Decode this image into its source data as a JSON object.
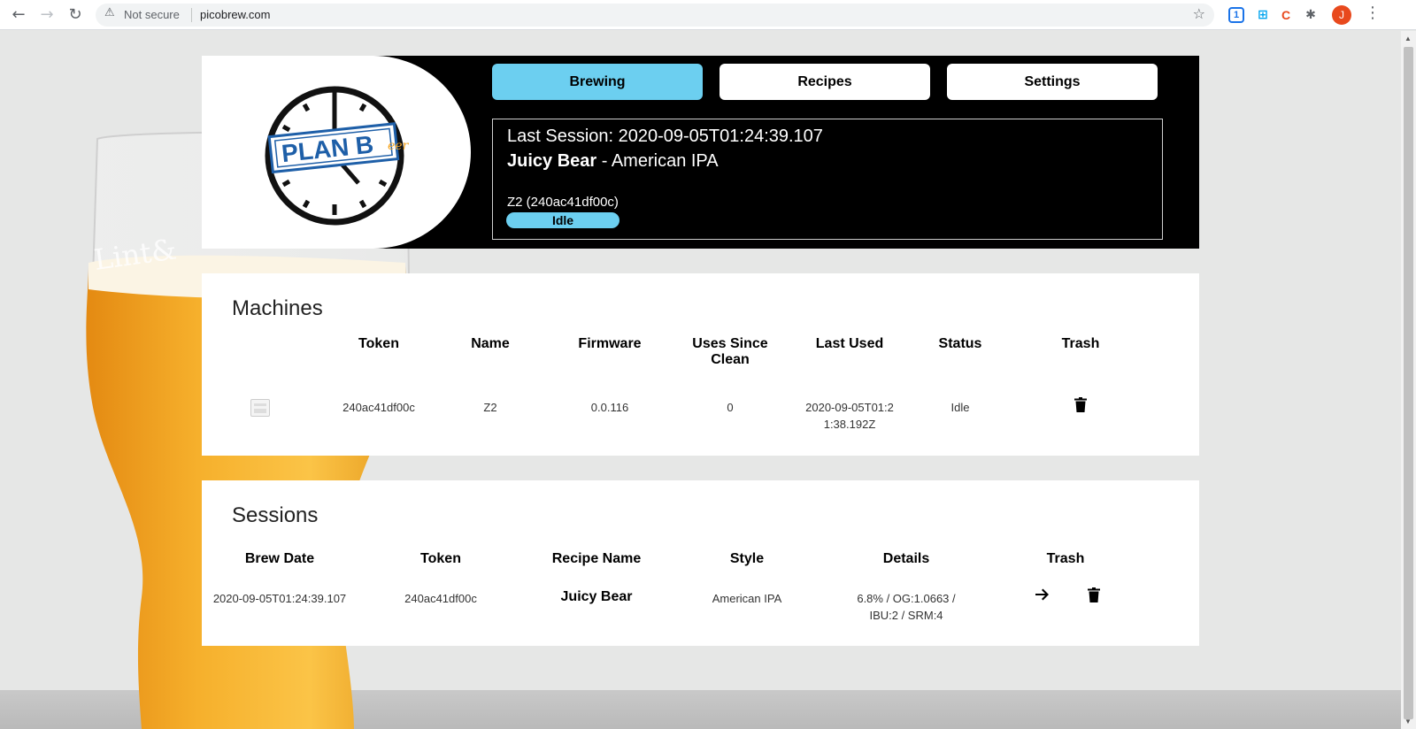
{
  "browser": {
    "security_label": "Not secure",
    "url": "picobrew.com",
    "profile_initial": "J",
    "extension_badge": "1"
  },
  "nav": {
    "tabs": [
      {
        "label": "Brewing",
        "active": true
      },
      {
        "label": "Recipes",
        "active": false
      },
      {
        "label": "Settings",
        "active": false
      }
    ]
  },
  "logo": {
    "text": "PLAN B",
    "suffix": "eer"
  },
  "current_session": {
    "last_session_text": "Last Session: 2020-09-05T01:24:39.107",
    "recipe_name": "Juicy Bear",
    "recipe_style_suffix": " - American IPA",
    "machine_label": "Z2 (240ac41df00c)",
    "status": "Idle"
  },
  "machines": {
    "title": "Machines",
    "headers": {
      "token": "Token",
      "name": "Name",
      "firmware": "Firmware",
      "uses_since_clean": "Uses Since Clean",
      "last_used": "Last Used",
      "status": "Status",
      "trash": "Trash"
    },
    "rows": [
      {
        "token": "240ac41df00c",
        "name": "Z2",
        "firmware": "0.0.116",
        "uses_since_clean": "0",
        "last_used": "2020-09-05T01:21:38.192Z",
        "status": "Idle"
      }
    ]
  },
  "sessions": {
    "title": "Sessions",
    "headers": {
      "brew_date": "Brew Date",
      "token": "Token",
      "recipe_name": "Recipe Name",
      "style": "Style",
      "details": "Details",
      "trash": "Trash"
    },
    "rows": [
      {
        "brew_date": "2020-09-05T01:24:39.107",
        "token": "240ac41df00c",
        "recipe_name": "Juicy Bear",
        "style": "American IPA",
        "details": "6.8% / OG:1.0663 / IBU:2 / SRM:4"
      }
    ]
  },
  "colors": {
    "accent": "#6ccff0",
    "header_bg": "#000000",
    "logo_blue": "#1e5fa8",
    "beer": "#f5a623"
  }
}
